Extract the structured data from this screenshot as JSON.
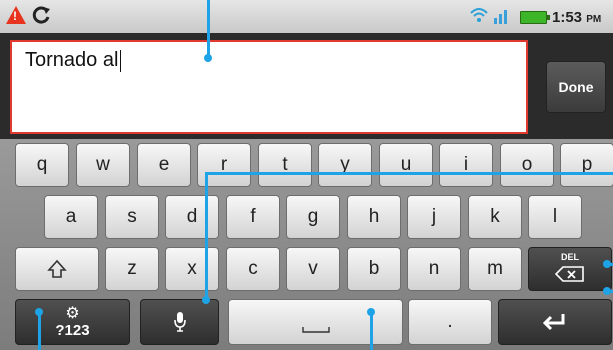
{
  "status_bar": {
    "warning_icon": "warning-icon",
    "sync_icon": "sync-icon",
    "wifi_icon": "wifi-icon",
    "signal_icon": "signal-icon",
    "battery_icon": "battery-icon",
    "time": "1:53",
    "ampm": "PM"
  },
  "editor": {
    "value": "Tornado al",
    "done_label": "Done"
  },
  "keyboard": {
    "row1": [
      "q",
      "w",
      "e",
      "r",
      "t",
      "y",
      "u",
      "i",
      "o",
      "p"
    ],
    "row2": [
      "a",
      "s",
      "d",
      "f",
      "g",
      "h",
      "j",
      "k",
      "l"
    ],
    "row3": [
      "z",
      "x",
      "c",
      "v",
      "b",
      "n",
      "m"
    ],
    "shift_icon": "shift-icon",
    "del_label": "DEL",
    "symbols_label": "?123",
    "period_label": ".",
    "voice_icon": "microphone-icon",
    "settings_icon": "gear-icon",
    "enter_icon": "enter-icon",
    "space_icon": "space-icon"
  },
  "colors": {
    "callout": "#1ea3e6",
    "text_border": "#e03a2e",
    "battery": "#3cb528"
  }
}
